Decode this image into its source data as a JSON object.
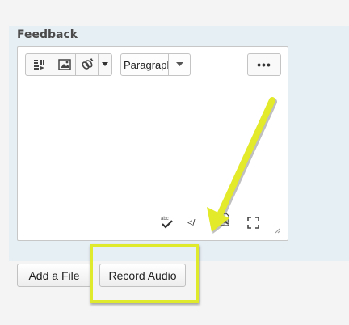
{
  "feedback": {
    "label": "Feedback"
  },
  "toolbar": {
    "insert_stuff_icon": "insert-stuff-icon",
    "image_icon": "image-icon",
    "link_icon": "link-icon",
    "link_dropdown_icon": "chevron-down-icon",
    "paragraph_value": "Paragraph",
    "more_label": "•••"
  },
  "statusbar": {
    "spellcheck_icon": "spellcheck-icon",
    "spellcheck_text": "abc",
    "html_editor_icon": "code-icon",
    "html_editor_text": "</",
    "preview_icon": "preview-icon",
    "fullscreen_icon": "fullscreen-icon",
    "resize_icon": "resize-handle-icon"
  },
  "actions": {
    "add_file_label": "Add a File",
    "record_audio_label": "Record Audio"
  },
  "colors": {
    "panel_bg": "#e6eff4",
    "highlight": "#e0ea2c"
  }
}
